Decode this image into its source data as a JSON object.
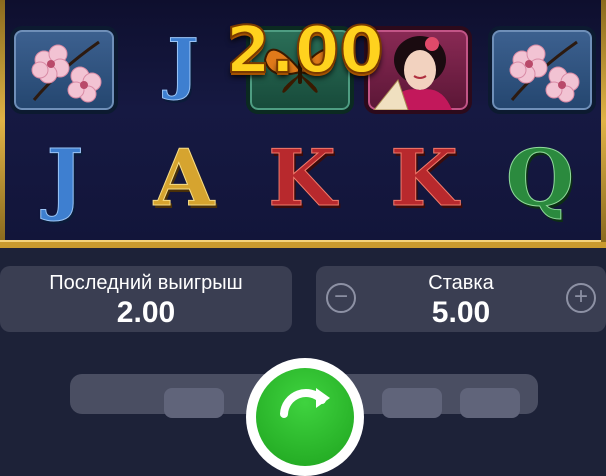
{
  "reels": {
    "top_row": [
      "blossom-symbol",
      "J",
      "butterfly-symbol",
      "geisha-symbol",
      "blossom-symbol"
    ],
    "middle_row": [
      "J",
      "A",
      "K",
      "K",
      "Q"
    ]
  },
  "win_display": {
    "amount": "2.00"
  },
  "last_win": {
    "label": "Последний выигрыш",
    "value": "2.00"
  },
  "bet": {
    "label": "Ставка",
    "value": "5.00",
    "decrease_icon": "minus-icon",
    "increase_icon": "plus-icon"
  },
  "controls": {
    "spin_icon": "refresh-icon"
  },
  "colors": {
    "frame_gold": "#c99a2e",
    "spin_green": "#1ea31e",
    "win_yellow": "#ffd21e"
  }
}
